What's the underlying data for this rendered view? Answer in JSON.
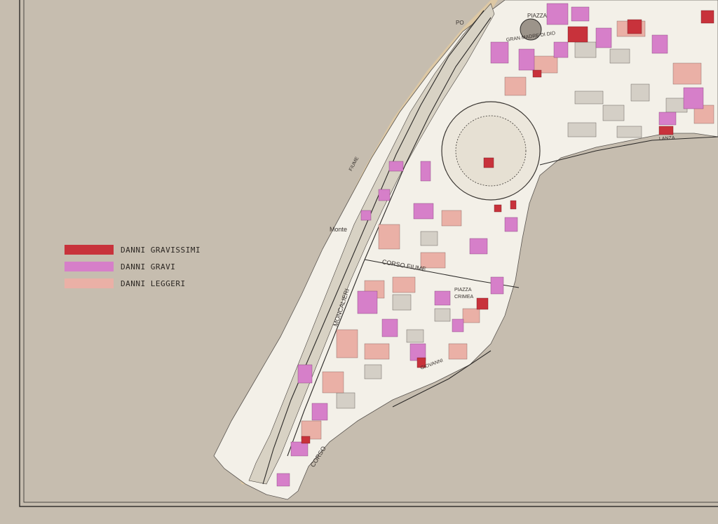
{
  "legend": {
    "items": [
      {
        "label": "DANNI  GRAVISSIMI",
        "color": "#c8323b"
      },
      {
        "label": "DANNI  GRAVI",
        "color": "#d67fc9"
      },
      {
        "label": "DANNI  LEGGERI",
        "color": "#eab0a6"
      }
    ]
  },
  "labels": {
    "piazza_top": "PIAZZA",
    "gran_madre": "GRAN MADRE DI DIO",
    "po": "PO",
    "fiume": "FIUME",
    "corso_fiume": "CORSO    FIUME",
    "corso": "CORSO",
    "moncalieri": "MONCALIERI",
    "piazza_crimea": "PIAZZA",
    "crimea": "CRIMEA",
    "via": "Via",
    "lanza": "LANZA",
    "giovanni": "GIOVANNI",
    "monte": "Monte"
  },
  "colors": {
    "paper": "#c6bdaf",
    "land": "#f2efe6",
    "river": "#ddc8a4",
    "line": "#2c2a28"
  }
}
